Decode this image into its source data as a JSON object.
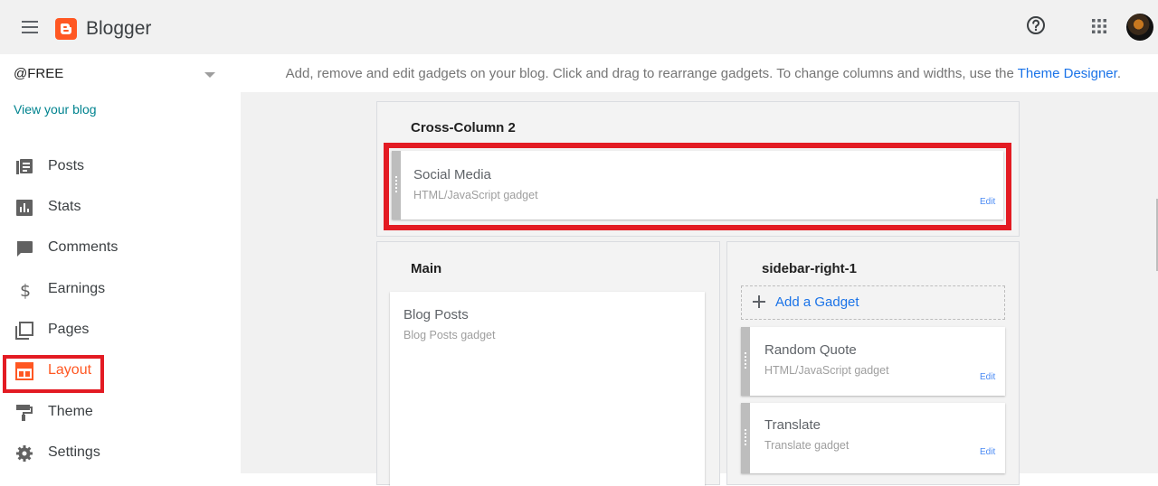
{
  "app": {
    "name": "Blogger"
  },
  "colors": {
    "accent": "#ff5722",
    "link": "#1a73e8",
    "highlight": "#e31b23"
  },
  "sidebar": {
    "blog_name": "@FREE",
    "view_blog": "View your blog",
    "items": [
      {
        "label": "Posts",
        "icon": "posts-icon"
      },
      {
        "label": "Stats",
        "icon": "stats-icon"
      },
      {
        "label": "Comments",
        "icon": "comments-icon"
      },
      {
        "label": "Earnings",
        "icon": "dollar-icon"
      },
      {
        "label": "Pages",
        "icon": "pages-icon"
      },
      {
        "label": "Layout",
        "icon": "layout-icon",
        "active": true
      },
      {
        "label": "Theme",
        "icon": "paint-roller-icon"
      },
      {
        "label": "Settings",
        "icon": "gear-icon"
      }
    ]
  },
  "main": {
    "info_text": "Add, remove and edit gadgets on your blog. Click and drag to rearrange gadgets. To change columns and widths, use the ",
    "info_link": "Theme Designer",
    "info_end": ".",
    "cross_column": {
      "title": "Cross-Column 2",
      "gadgets": [
        {
          "title": "Social Media",
          "subtitle": "HTML/JavaScript gadget",
          "edit": "Edit"
        }
      ]
    },
    "main_section": {
      "title": "Main",
      "gadgets": [
        {
          "title": "Blog Posts",
          "subtitle": "Blog Posts gadget"
        }
      ]
    },
    "sidebar_right": {
      "title": "sidebar-right-1",
      "add_label": "Add a Gadget",
      "gadgets": [
        {
          "title": "Random Quote",
          "subtitle": "HTML/JavaScript gadget",
          "edit": "Edit"
        },
        {
          "title": "Translate",
          "subtitle": "Translate gadget",
          "edit": "Edit"
        }
      ]
    }
  }
}
